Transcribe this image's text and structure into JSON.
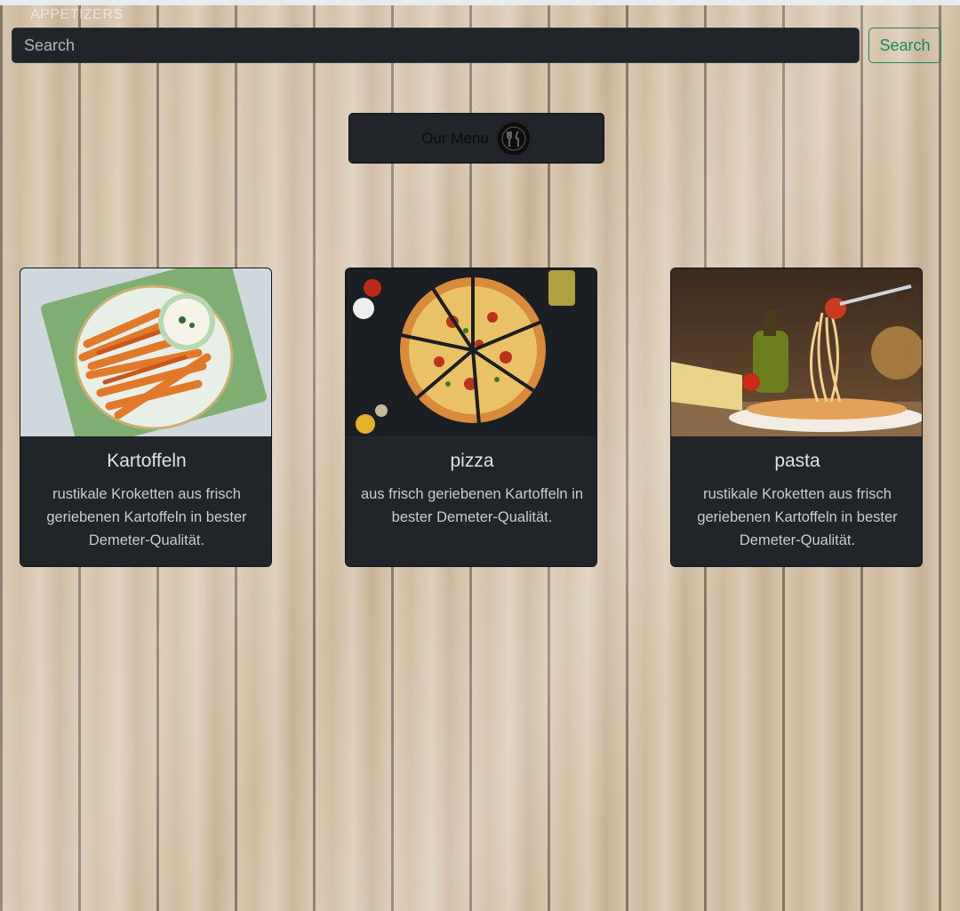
{
  "brand": {
    "text": "APPETIZERS"
  },
  "search": {
    "placeholder": "Search",
    "button_label": "Search"
  },
  "menu_button": {
    "label": "Our Menu",
    "icon": "fork-knife-icon"
  },
  "cards": [
    {
      "title": "Kartoffeln",
      "text": "rustikale Kroketten aus frisch geriebenen Kartoffeln in bester Demeter-Qualität."
    },
    {
      "title": "pizza",
      "text": "aus frisch geriebenen Kartoffeln in bester Demeter-Qualität."
    },
    {
      "title": "pasta",
      "text": "rustikale Kroketten aus frisch geriebenen Kartoffeln in bester Demeter-Qualität."
    }
  ],
  "colors": {
    "accent": "#198754",
    "card_bg": "#212529"
  }
}
